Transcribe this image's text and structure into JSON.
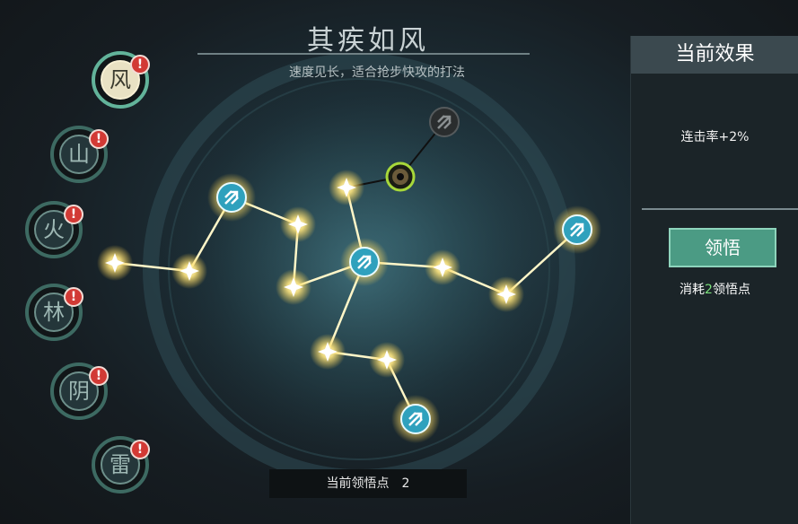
{
  "constellation": {
    "title": "其疾如风",
    "subtitle": "速度见长，适合抢步快攻的打法"
  },
  "tabs": [
    {
      "label": "风",
      "alert": "!",
      "active": true
    },
    {
      "label": "山",
      "alert": "!",
      "active": false
    },
    {
      "label": "火",
      "alert": "!",
      "active": false
    },
    {
      "label": "林",
      "alert": "!",
      "active": false
    },
    {
      "label": "阴",
      "alert": "!",
      "active": false
    },
    {
      "label": "雷",
      "alert": "!",
      "active": false
    }
  ],
  "current_effect": {
    "header": "当前效果",
    "text": "连击率+2%"
  },
  "comprehend": {
    "button_label": "领悟",
    "cost_prefix": "消耗",
    "cost_value": "2",
    "cost_suffix": "领悟点"
  },
  "points": {
    "label": "当前领悟点",
    "value": "2"
  },
  "colors": {
    "accent_green": "#4b9b84",
    "node_glow": "#fff4b0",
    "alert_red": "#d23a35"
  },
  "nodes": [
    {
      "id": "n-arrow-1",
      "kind": "arrow-lit"
    },
    {
      "id": "n-star-2",
      "kind": "star-lit"
    },
    {
      "id": "n-star-3",
      "kind": "star-lit"
    },
    {
      "id": "n-star-4",
      "kind": "star-lit"
    },
    {
      "id": "n-star-5",
      "kind": "star-lit"
    },
    {
      "id": "n-star-6",
      "kind": "star-lit"
    },
    {
      "id": "n-selected",
      "kind": "selected"
    },
    {
      "id": "n-locked",
      "kind": "arrow-locked"
    },
    {
      "id": "n-arrow-center",
      "kind": "arrow-lit"
    },
    {
      "id": "n-star-7",
      "kind": "star-lit"
    },
    {
      "id": "n-star-8",
      "kind": "star-lit"
    },
    {
      "id": "n-arrow-right",
      "kind": "arrow-lit"
    },
    {
      "id": "n-star-9",
      "kind": "star-lit"
    },
    {
      "id": "n-star-10",
      "kind": "star-lit"
    },
    {
      "id": "n-arrow-bottom",
      "kind": "arrow-lit"
    }
  ]
}
